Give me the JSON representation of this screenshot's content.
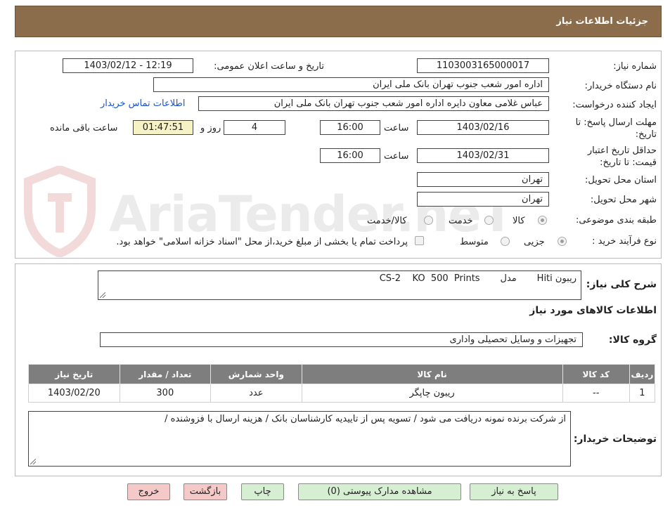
{
  "header": {
    "title": "جزئیات اطلاعات نیاز"
  },
  "watermark": {
    "text": "AriaTender.neT"
  },
  "labels": {
    "need_number": "شماره نیاز:",
    "announce_datetime": "تاریخ و ساعت اعلان عمومی:",
    "buyer_org": "نام دستگاه خریدار:",
    "requester": "ایجاد کننده درخواست:",
    "reply_deadline": "مهلت ارسال پاسخ: تا تاریخ:",
    "time": "ساعت",
    "day_and": "روز و",
    "remaining": "ساعت باقی مانده",
    "price_validity": "حداقل تاریخ اعتبار قیمت: تا تاریخ:",
    "province": "استان محل تحویل:",
    "city": "شهر محل تحویل:",
    "category": "طبقه بندی موضوعی:",
    "process_type": "نوع فرآیند خرید :",
    "general_desc": "شرح کلی نیاز:",
    "goods_info": "اطلاعات کالاهای مورد نیاز",
    "goods_group": "گروه کالا:",
    "buyer_notes": "توضیحات خریدار:"
  },
  "values": {
    "need_number": "1103003165000017",
    "announce_datetime": "1403/02/12 - 12:19",
    "buyer_org": "اداره امور شعب جنوب تهران بانک ملی ایران",
    "requester": "عباس غلامی معاون دایره اداره امور شعب جنوب تهران بانک ملی ایران",
    "contact_link": "اطلاعات تماس خریدار",
    "reply_date": "1403/02/16",
    "reply_time": "16:00",
    "days": "4",
    "remaining_time": "01:47:51",
    "validity_date": "1403/02/31",
    "validity_time": "16:00",
    "province": "تهران",
    "city": "تهران",
    "general_desc": "ریبون Hiti       مدل       CS-2    KO  500  Prints",
    "goods_group": "تجهیزات و وسایل تحصیلی واداری",
    "buyer_notes": "از شرکت برنده نمونه دریافت  می شود / تسویه پس از تاییدیه کارشناسان بانک / هزینه ارسال با فزوشنده /"
  },
  "category_options": {
    "goods": "کالا",
    "service": "خدمت",
    "goods_service": "کالا/خدمت",
    "selected": "goods"
  },
  "process_options": {
    "partial": "جزیی",
    "medium": "متوسط",
    "note": "پرداخت تمام یا بخشی از مبلغ خرید،از محل \"اسناد خزانه اسلامی\" خواهد بود.",
    "selected": "partial"
  },
  "table": {
    "headers": [
      "ردیف",
      "کد کالا",
      "نام کالا",
      "واحد شمارش",
      "تعداد / مقدار",
      "تاریخ نیاز"
    ],
    "rows": [
      [
        "1",
        "--",
        "ریبون چاپگر",
        "عدد",
        "300",
        "1403/02/20"
      ]
    ]
  },
  "buttons": {
    "reply": "پاسخ به نیاز",
    "attachments": "مشاهده مدارک پیوستی (0)",
    "print": "چاپ",
    "back": "بازگشت",
    "exit": "خروج"
  }
}
